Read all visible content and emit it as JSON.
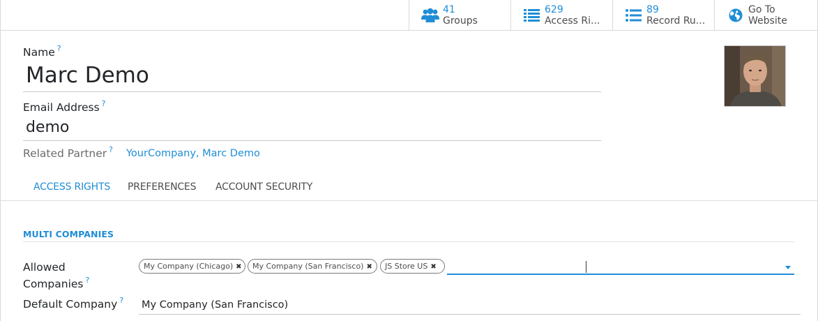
{
  "smart_buttons": [
    {
      "value": "41",
      "label": "Groups",
      "icon": "users-icon"
    },
    {
      "value": "629",
      "label": "Access Ri...",
      "icon": "list-icon"
    },
    {
      "value": "89",
      "label": "Record Ru...",
      "icon": "list-icon"
    },
    {
      "value": "Go To",
      "label": "Website",
      "icon": "globe-icon"
    }
  ],
  "form": {
    "name_label": "Name",
    "name_value": "Marc Demo",
    "email_label": "Email Address",
    "email_value": "demo",
    "partner_label": "Related Partner",
    "partner_value": "YourCompany, Marc Demo",
    "help_mark": "?"
  },
  "tabs": [
    {
      "label": "ACCESS RIGHTS",
      "active": true
    },
    {
      "label": "PREFERENCES",
      "active": false
    },
    {
      "label": "ACCOUNT SECURITY",
      "active": false
    }
  ],
  "multi_companies": {
    "title": "MULTI COMPANIES",
    "allowed_label_1": "Allowed",
    "allowed_label_2": "Companies",
    "allowed": [
      {
        "label": "My Company (Chicago)",
        "remove": "✖"
      },
      {
        "label": "My Company (San Francisco)",
        "remove": "✖"
      },
      {
        "label": "JS Store US",
        "remove": "✖"
      }
    ],
    "default_label": "Default Company",
    "default_value": "My Company (San Francisco)"
  },
  "colors": {
    "accent": "#1f8dd6",
    "text": "#212529",
    "border": "#d8d8d8"
  }
}
